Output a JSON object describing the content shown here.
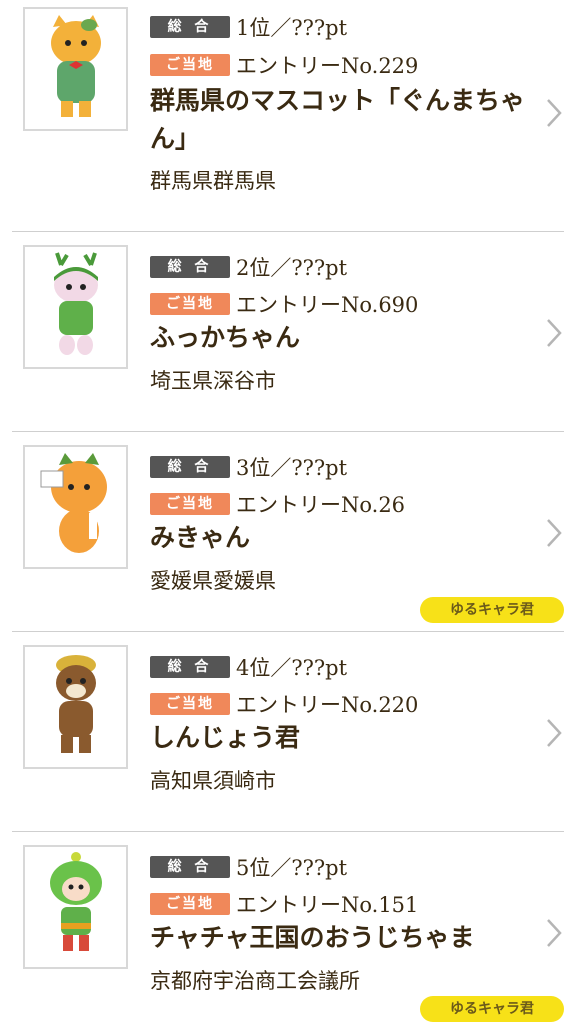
{
  "labels": {
    "overall": "総 合",
    "local": "ご当地"
  },
  "items": [
    {
      "rank": "1位／???pt",
      "entry": "エントリーNo.229",
      "name": "群馬県のマスコット「ぐんまちゃん」",
      "place": "群馬県群馬県",
      "tag": ""
    },
    {
      "rank": "2位／???pt",
      "entry": "エントリーNo.690",
      "name": "ふっかちゃん",
      "place": "埼玉県深谷市",
      "tag": ""
    },
    {
      "rank": "3位／???pt",
      "entry": "エントリーNo.26",
      "name": "みきゃん",
      "place": "愛媛県愛媛県",
      "tag": "ゆるキャラ君"
    },
    {
      "rank": "4位／???pt",
      "entry": "エントリーNo.220",
      "name": "しんじょう君",
      "place": "高知県須崎市",
      "tag": ""
    },
    {
      "rank": "5位／???pt",
      "entry": "エントリーNo.151",
      "name": "チャチャ王国のおうじちゃま",
      "place": "京都府宇治商工会議所",
      "tag": "ゆるキャラ君"
    }
  ],
  "colors": {
    "badge_overall": "#555555",
    "badge_local": "#f0885a",
    "tag_bg": "#f7e118",
    "text": "#3a2a12",
    "divider": "#cfcfcf"
  },
  "icons": {
    "row_arrow": "chevron-right-icon"
  }
}
